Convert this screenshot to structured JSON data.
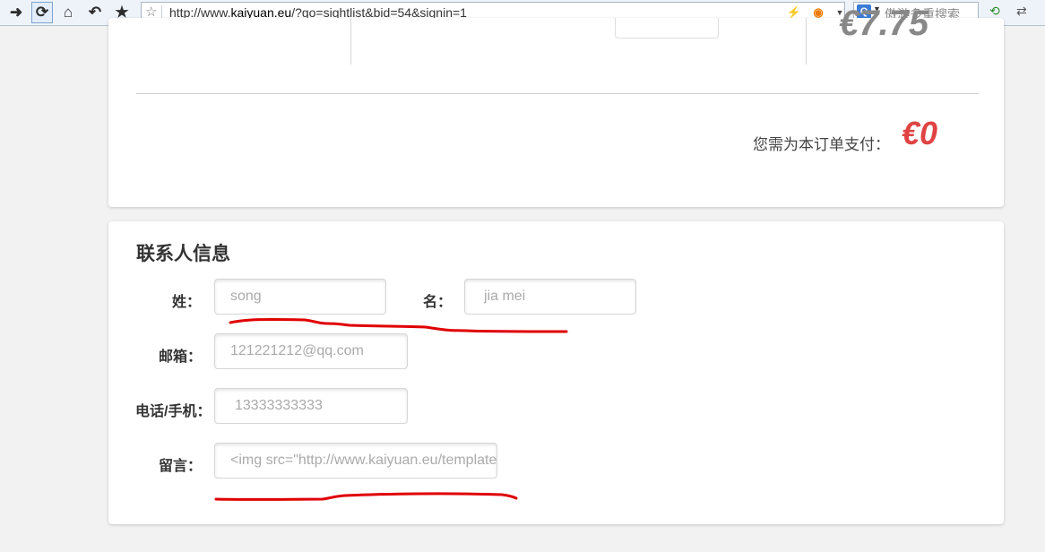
{
  "browser": {
    "url_prefix": "http://www.",
    "url_domain": "kaiyuan.eu",
    "url_path": "/?go=sightlist&bid=54&signin=1",
    "search_placeholder": "傲游多重搜索",
    "nav_icons": [
      "forward-icon",
      "refresh-icon",
      "home-icon",
      "undo-icon",
      "favorites-icon"
    ],
    "right_icons": [
      "translate-icon",
      "dictionary-icon"
    ]
  },
  "order": {
    "partial_price": "€7.75",
    "pay_label": "您需为本订单支付：",
    "pay_amount": "€0"
  },
  "contact": {
    "title": "联系人信息",
    "surname_label": "姓：",
    "surname_value": "song",
    "given_label": "名：",
    "given_value": "jia mei",
    "email_label": "邮箱：",
    "email_value": "121221212@qq.com",
    "phone_label": "电话/手机：",
    "phone_value": "13333333333",
    "message_label": "留言：",
    "message_value": "<img src=\"http://www.kaiyuan.eu/templates"
  },
  "colors": {
    "accent_price": "#e04343",
    "annotation_red": "#e00000",
    "page_bg": "#f2f2f2"
  }
}
